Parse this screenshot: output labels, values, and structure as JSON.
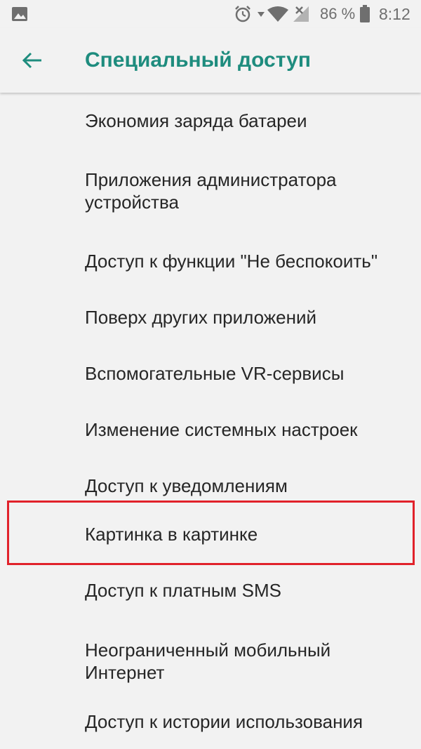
{
  "status_bar": {
    "battery_percent": "86 %",
    "time": "8:12",
    "icons": [
      "image-icon",
      "alarm-icon",
      "signal-arrow-icon",
      "wifi-icon",
      "no-signal-icon",
      "battery-icon"
    ],
    "icon_color": "#6f6f6f"
  },
  "toolbar": {
    "title": "Специальный доступ",
    "back_icon": "arrow-left-icon",
    "accent_color": "#1e8c7e"
  },
  "items": [
    {
      "label": "Экономия заряда батареи"
    },
    {
      "label": "Приложения администратора устройства"
    },
    {
      "label": "Доступ к функции \"Не беспокоить\""
    },
    {
      "label": "Поверх других приложений"
    },
    {
      "label": "Вспомогательные VR-сервисы"
    },
    {
      "label": "Изменение системных настроек"
    },
    {
      "label": "Доступ к уведомлениям"
    },
    {
      "label": "Картинка в картинке"
    },
    {
      "label": "Доступ к платным SMS"
    },
    {
      "label": "Неограниченный мобильный Интернет"
    },
    {
      "label": "Доступ к истории использования"
    }
  ],
  "highlight": {
    "target_item": "Картинка в картинке",
    "color": "#e1222b"
  }
}
